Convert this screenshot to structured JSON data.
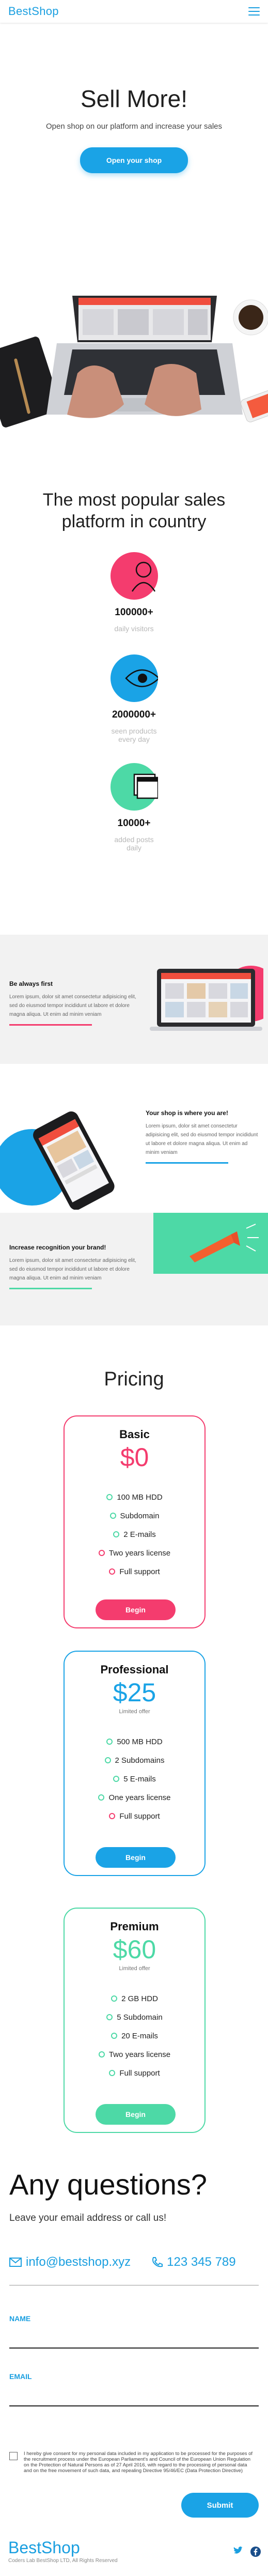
{
  "header": {
    "logo": "BestShop"
  },
  "hero": {
    "title": "Sell More!",
    "subtitle": "Open shop on our platform and increase your sales",
    "cta": "Open your shop"
  },
  "popular": {
    "title_line1": "The most popular sales",
    "title_line2": "platform in country",
    "stats": [
      {
        "value": "100000+",
        "label": "daily visitors",
        "icon": "user-icon",
        "color": "#f43c6e"
      },
      {
        "value": "2000000+",
        "label_line1": "seen products",
        "label_line2": "every day",
        "icon": "eye-icon",
        "color": "#1aa3e6"
      },
      {
        "value": "10000+",
        "label_line1": "added posts",
        "label_line2": "daily",
        "icon": "gallery-icon",
        "color": "#4dd9a6"
      }
    ]
  },
  "features": [
    {
      "title": "Be always first",
      "text": "Lorem ipsum, dolor sit amet consectetur adipisicing elit, sed do eiusmod tempor incididunt ut labore et dolore magna aliqua. Ut enim ad minim veniam"
    },
    {
      "title": "Your shop is where you are!",
      "text": "Lorem ipsum, dolor sit amet consectetur adipisicing elit, sed do eiusmod tempor incididunt ut labore et dolore magna aliqua. Ut enim ad minim veniam"
    },
    {
      "title": "Increase recognition your brand!",
      "text": "Lorem ipsum, dolor sit amet consectetur adipisicing elit, sed do eiusmod tempor incididunt ut labore et dolore magna aliqua. Ut enim ad minim veniam"
    }
  ],
  "pricing": {
    "title": "Pricing",
    "plans": [
      {
        "name": "Basic",
        "price": "$0",
        "limited": "",
        "color": "#f43c6e",
        "features": [
          "100 MB HDD",
          "Subdomain",
          "2 E-mails",
          "Two years license",
          "Full support"
        ],
        "button": "Begin"
      },
      {
        "name": "Professional",
        "price": "$25",
        "limited": "Limited offer",
        "color": "#1aa3e6",
        "features": [
          "500 MB HDD",
          "2 Subdomains",
          "5 E-mails",
          "One years license",
          "Full support"
        ],
        "button": "Begin"
      },
      {
        "name": "Premium",
        "price": "$60",
        "limited": "Limited offer",
        "color": "#4dd9a6",
        "features": [
          "2 GB HDD",
          "5 Subdomain",
          "20 E-mails",
          "Two years license",
          "Full support"
        ],
        "button": "Begin"
      }
    ]
  },
  "contact": {
    "title": "Any questions?",
    "subtitle": "Leave your email address or call us!",
    "email": "info@bestshop.xyz",
    "phone": "123 345 789",
    "name_label": "NAME",
    "email_label": "EMAIL",
    "consent": "I hereby give consent for my personal data included in my application to be processed for the purposes of the recruitment process under the European Parliament's and Council of the European Union Regulation on the Protection of Natural Persons as of 27 April 2016, with regard to the processing of personal data and on the free movement of such data, and repealing Directive 95/46/EC (Data Protection Directive)",
    "submit": "Submit"
  },
  "footer": {
    "logo": "BestShop",
    "copyright": "Coders Lab BestShop LTD, All Rights Reserved"
  },
  "colors": {
    "blue": "#1aa3e6",
    "pink": "#f43c6e",
    "green": "#4dd9a6"
  }
}
